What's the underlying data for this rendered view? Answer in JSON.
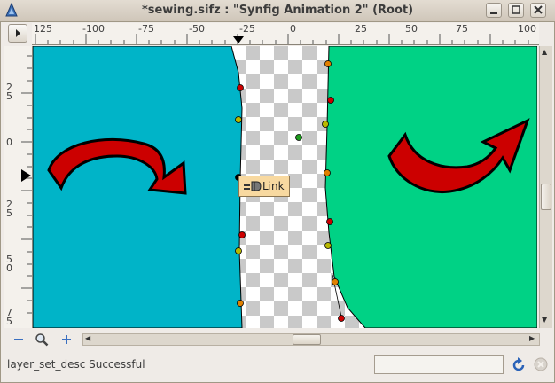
{
  "window": {
    "title": "*sewing.sifz : \"Synfig Animation 2\" (Root)",
    "icon": "synfig-app-icon",
    "controls": [
      "minimize",
      "maximize",
      "close"
    ]
  },
  "ruler": {
    "horizontal_labels": [
      "125",
      "-100",
      "-75",
      "-50",
      "-25",
      "0",
      "25",
      "50",
      "75",
      "100"
    ],
    "vertical_labels": [
      "2 5",
      "0",
      "2 5",
      "5 0",
      "7 5"
    ]
  },
  "canvas": {
    "colors": {
      "left_region": "#00b4c8",
      "right_region": "#00d285",
      "arrow_fill": "#cc0000",
      "arrow_outline": "#000000",
      "duck_red": "#cc0000",
      "duck_yellow": "#b8b800",
      "duck_orange": "#e08000",
      "duck_green": "#1e9c1e"
    },
    "tooltip_label": "Link",
    "tooltip_icon": "link-icon"
  },
  "toolbar": {
    "zoom_out_icon": "zoom-out-icon",
    "zoom_fit_icon": "zoom-fit-icon",
    "zoom_in_icon": "zoom-in-icon"
  },
  "status": {
    "message": "layer_set_desc Successful",
    "refresh_icon": "refresh-icon",
    "stop_icon": "stop-icon"
  }
}
